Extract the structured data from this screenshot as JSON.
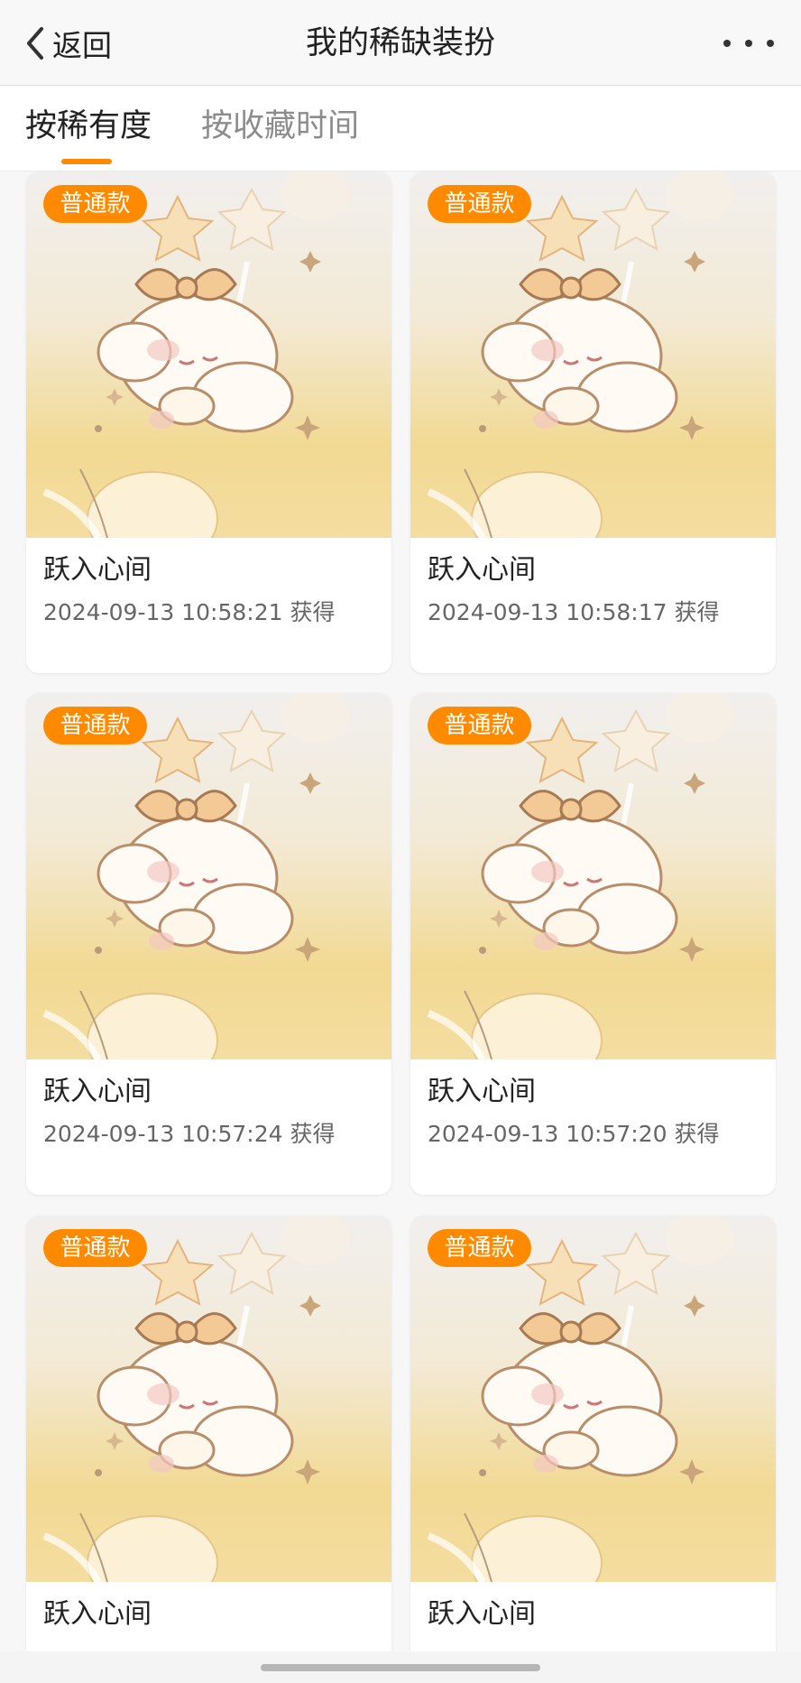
{
  "header": {
    "back_label": "返回",
    "title": "我的稀缺装扮",
    "more_icon": "more-dots-icon"
  },
  "tabs": [
    {
      "label": "按稀有度",
      "active": true
    },
    {
      "label": "按收藏时间",
      "active": false
    }
  ],
  "accent_color": "#ff8a00",
  "cards": [
    {
      "badge": "普通款",
      "name": "跃入心间",
      "time": "2024-09-13 10:58:21 获得"
    },
    {
      "badge": "普通款",
      "name": "跃入心间",
      "time": "2024-09-13 10:58:17 获得"
    },
    {
      "badge": "普通款",
      "name": "跃入心间",
      "time": "2024-09-13 10:57:24 获得"
    },
    {
      "badge": "普通款",
      "name": "跃入心间",
      "time": "2024-09-13 10:57:20 获得"
    },
    {
      "badge": "普通款",
      "name": "跃入心间",
      "time": ""
    },
    {
      "badge": "普通款",
      "name": "跃入心间",
      "time": ""
    }
  ]
}
